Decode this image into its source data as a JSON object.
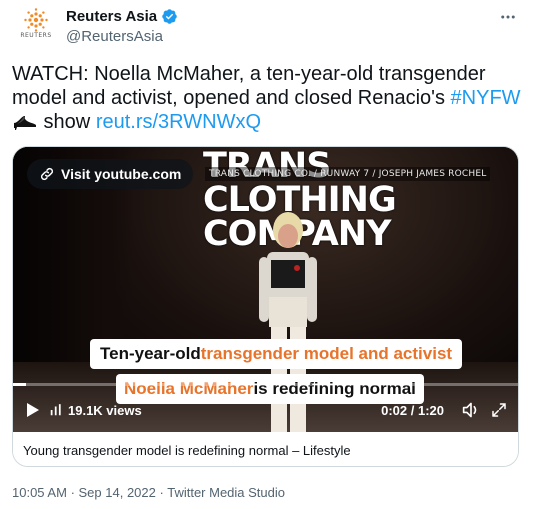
{
  "header": {
    "display_name": "Reuters Asia",
    "handle": "@ReutersAsia",
    "avatar_text": "REUTERS",
    "verified": true
  },
  "tweet": {
    "text_part1": "WATCH: Noella McMaher, a ten-year-old transgender model and activist, opened and closed Renacio's ",
    "hashtag": "#NYFW",
    "text_part2": " show ",
    "link": "reut.rs/3RWNWxQ"
  },
  "video": {
    "visit_label": "Visit youtube.com",
    "title_lines": [
      "TRANS",
      "CLOTHING",
      "COMPANY"
    ],
    "overlay_caption": "TRANS CLOTHING CO. / RUNWAY 7 / JOSEPH JAMES ROCHEL",
    "subtitle1_plain": "Ten-year-old ",
    "subtitle1_highlight": "transgender model and activist",
    "subtitle2_highlight": "Noella McMaher",
    "subtitle2_plain": " is redefining normal",
    "views": "19.1K views",
    "time": "0:02 / 1:20",
    "progress": 0.025
  },
  "card": {
    "caption": "Young transgender model is redefining normal – Lifestyle"
  },
  "meta": {
    "time": "10:05 AM",
    "date": "Sep 14, 2022",
    "source": "Twitter Media Studio"
  },
  "colors": {
    "accent": "#1d9bf0",
    "subtitle_highlight": "#e8732a",
    "muted": "#536471"
  }
}
